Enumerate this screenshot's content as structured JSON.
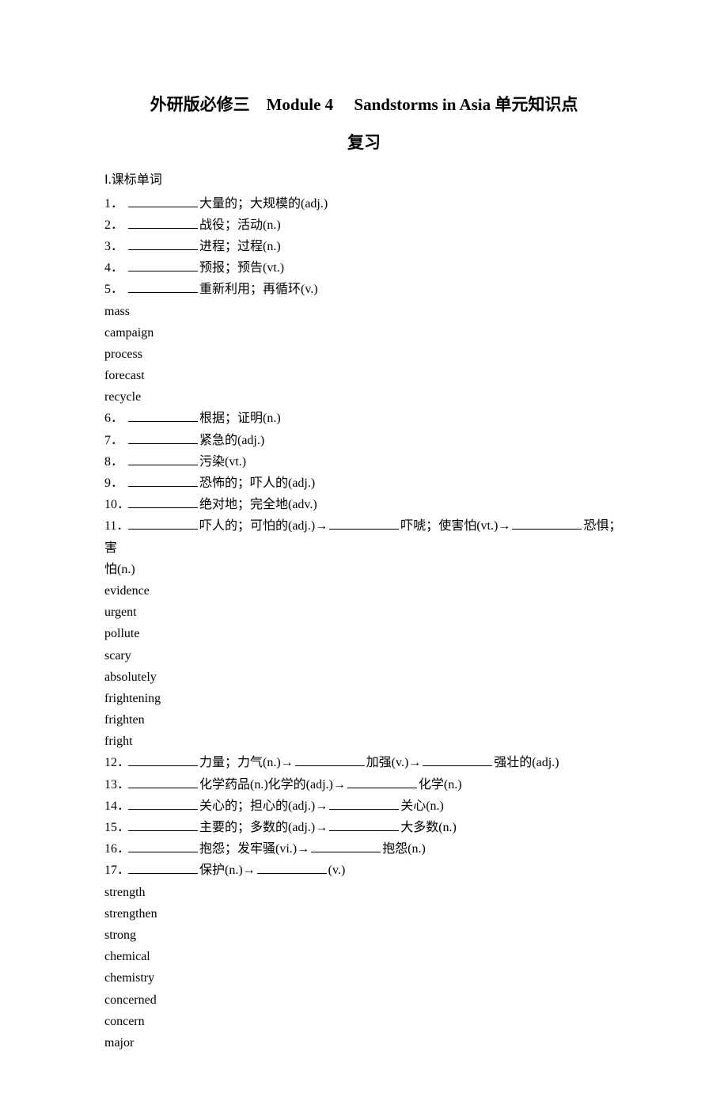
{
  "title_line1": "外研版必修三　Module 4　  Sandstorms in Asia 单元知识点",
  "title_line2": "复习",
  "section1_label": "Ⅰ.课标单词",
  "q1": {
    "num": "1．",
    "text": "大量的；大规模的(adj.)"
  },
  "q2": {
    "num": "2．",
    "text": "战役；活动(n.)"
  },
  "q3": {
    "num": "3．",
    "text": "进程；过程(n.)"
  },
  "q4": {
    "num": "4．",
    "text": "预报；预告(vt.)"
  },
  "q5": {
    "num": "5．",
    "text": "重新利用；再循环(v.)"
  },
  "a1": "mass",
  "a2": "campaign",
  "a3": "process",
  "a4": "forecast",
  "a5": "recycle",
  "q6": {
    "num": "6．",
    "text": "根据；证明(n.)"
  },
  "q7": {
    "num": "7．",
    "text": "紧急的(adj.)"
  },
  "q8": {
    "num": "8．",
    "text": "污染(vt.)"
  },
  "q9": {
    "num": "9．",
    "text": "恐怖的；吓人的(adj.)"
  },
  "q10": {
    "num": "10．",
    "text": "绝对地；完全地(adv.)"
  },
  "q11": {
    "num": "11．",
    "part1": "吓人的；可怕的(adj.)→",
    "part2": "吓唬；使害怕(vt.)→",
    "part3": "恐惧；害"
  },
  "q11b": "怕(n.)",
  "a6": "evidence",
  "a7": "urgent",
  "a8": "pollute",
  "a9": "scary",
  "a10": "absolutely",
  "a11a": "frightening",
  "a11b": "frighten",
  "a11c": "fright",
  "q12": {
    "num": "12．",
    "part1": "力量；力气(n.)→",
    "part2": "加强(v.)→",
    "part3": "强壮的(adj.)"
  },
  "q13": {
    "num": "13．",
    "part1": "化学药品(n.)化学的(adj.)→",
    "part2": "化学(n.)"
  },
  "q14": {
    "num": "14．",
    "part1": "关心的；担心的(adj.)→",
    "part2": "关心(n.)"
  },
  "q15": {
    "num": "15．",
    "part1": "主要的；多数的(adj.)→",
    "part2": "大多数(n.)"
  },
  "q16": {
    "num": "16．",
    "part1": "抱怨；发牢骚(vi.)→",
    "part2": "抱怨(n.)"
  },
  "q17": {
    "num": "17．",
    "part1": "保护(n.)→",
    "part2": "(v.)"
  },
  "a12a": "strength",
  "a12b": "strengthen",
  "a12c": "strong",
  "a13a": "chemical",
  "a13b": "chemistry",
  "a14a": "concerned",
  "a14b": "concern",
  "a15a": "major"
}
